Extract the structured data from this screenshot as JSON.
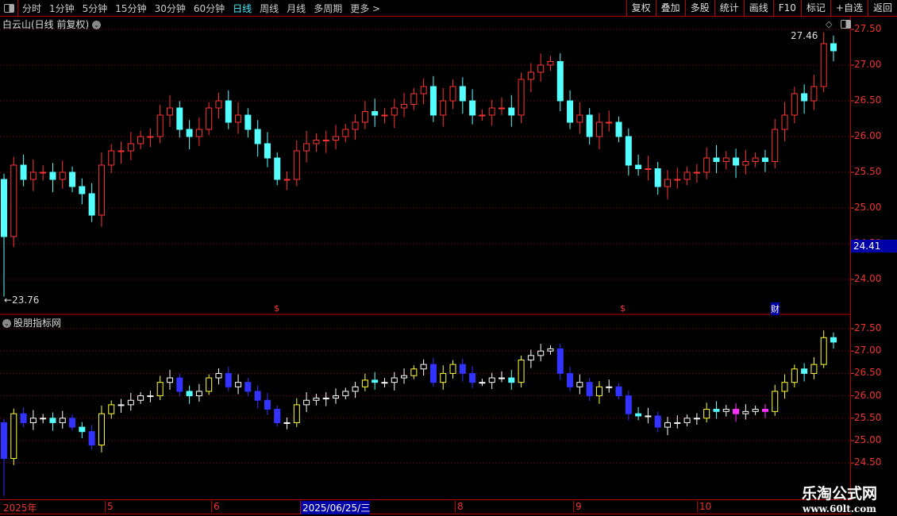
{
  "toolbar": {
    "periods": [
      "分时",
      "1分钟",
      "5分钟",
      "15分钟",
      "30分钟",
      "60分钟",
      "日线",
      "周线",
      "月线",
      "多周期",
      "更多 >"
    ],
    "active": "日线",
    "right": [
      "复权",
      "叠加",
      "多股",
      "统计",
      "画线",
      "F10",
      "标记",
      "+自选",
      "返回"
    ]
  },
  "main_title": "白云山(日线 前复权)",
  "indicator_title": "股朋指标网",
  "current_price_tag": "24.41",
  "high_label": "27.46",
  "low_label": "←23.76",
  "markers": [
    "$",
    "$",
    "财"
  ],
  "date_axis": [
    "2025年",
    "5",
    "6",
    "2025/06/25/三",
    "8",
    "9",
    "10"
  ],
  "watermark": {
    "name": "乐淘公式网",
    "url": "www.60lt.com"
  },
  "colors": {
    "up": "#ff3333",
    "down": "#54ffff",
    "axis": "#ff3333",
    "grid": "#8b0000"
  },
  "chart_data": {
    "type": "candlestick",
    "price_axis_top": [
      "27.50",
      "27.00",
      "26.50",
      "26.00",
      "25.50",
      "25.00",
      "24.50",
      "24.00"
    ],
    "price_axis_bottom": [
      "27.50",
      "27.00",
      "26.50",
      "26.00",
      "25.50",
      "25.00",
      "24.50"
    ],
    "closes": [
      24.6,
      25.6,
      25.4,
      25.5,
      25.5,
      25.4,
      25.5,
      25.3,
      25.2,
      24.9,
      25.6,
      25.8,
      25.8,
      25.9,
      26.0,
      26.0,
      26.3,
      26.4,
      26.1,
      26.0,
      26.1,
      26.4,
      26.5,
      26.2,
      26.3,
      26.1,
      25.9,
      25.7,
      25.4,
      25.4,
      25.8,
      25.9,
      25.95,
      25.95,
      26.0,
      26.1,
      26.2,
      26.35,
      26.3,
      26.3,
      26.4,
      26.45,
      26.6,
      26.7,
      26.3,
      26.5,
      26.7,
      26.5,
      26.3,
      26.3,
      26.4,
      26.4,
      26.3,
      26.8,
      26.9,
      27.0,
      27.05,
      26.5,
      26.2,
      26.3,
      26.0,
      26.2,
      26.2,
      26.0,
      25.6,
      25.55,
      25.55,
      25.3,
      25.4,
      25.4,
      25.5,
      25.5,
      25.7,
      25.65,
      25.7,
      25.6,
      25.65,
      25.7,
      25.65,
      26.1,
      26.3,
      26.6,
      26.5,
      26.7,
      27.3,
      27.2
    ],
    "first_open": 25.4,
    "low_min": 23.76,
    "high_max": 27.46
  }
}
